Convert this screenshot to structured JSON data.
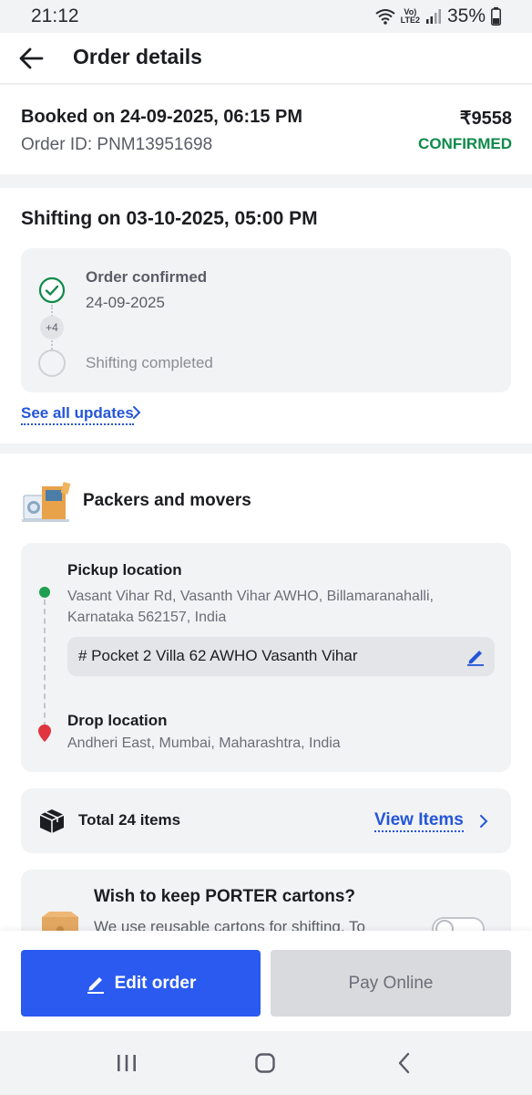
{
  "status_bar": {
    "time": "21:12",
    "network": "VoLTE2",
    "battery": "35%"
  },
  "header": {
    "title": "Order details",
    "back_icon": "arrow-left-icon"
  },
  "booking": {
    "booked_on": "Booked on 24-09-2025, 06:15 PM",
    "order_id": "Order ID: PNM13951698",
    "amount": "₹9558",
    "status": "CONFIRMED",
    "status_color": "#0f8a4a"
  },
  "shifting": {
    "title": "Shifting on 03-10-2025, 05:00 PM",
    "timeline": {
      "first_label": "Order confirmed",
      "first_date": "24-09-2025",
      "hidden_count": "+4",
      "last_label": "Shifting completed"
    },
    "see_all": "See all updates"
  },
  "service": {
    "title": "Packers and movers",
    "pickup_label": "Pickup location",
    "pickup_address": "Vasant Vihar Rd, Vasanth Vihar AWHO, Billamaranahalli, Karnataka 562157, India",
    "pickup_detail": "# Pocket 2 Villa 62 AWHO Vasanth Vihar",
    "drop_label": "Drop location",
    "drop_address": "Andheri East, Mumbai, Maharashtra, India"
  },
  "items": {
    "total": "Total 24 items",
    "view_link": "View Items"
  },
  "cartons": {
    "title": "Wish to keep PORTER cartons?",
    "description": "We use reusable cartons for shifting. To",
    "toggle_on": false
  },
  "actions": {
    "edit_label": "Edit order",
    "pay_label": "Pay Online"
  },
  "colors": {
    "primary": "#2a5af0",
    "link": "#2456d8",
    "success": "#0f8a4a",
    "drop_pin": "#e0343f"
  }
}
